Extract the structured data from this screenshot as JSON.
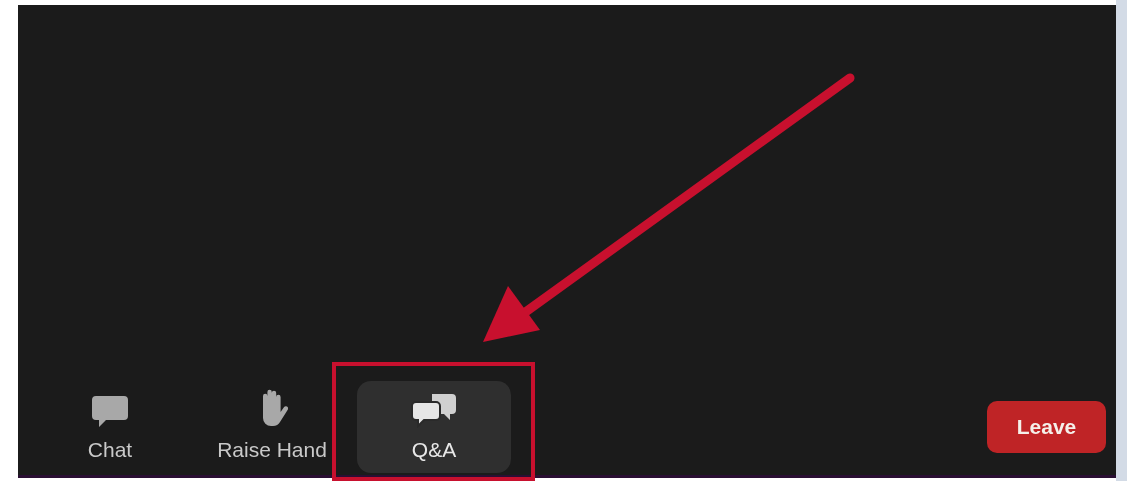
{
  "toolbar": [
    {
      "kind": "chat",
      "label": "Chat",
      "selected": false,
      "annotated": false
    },
    {
      "kind": "hand",
      "label": "Raise Hand",
      "selected": false,
      "annotated": false
    },
    {
      "kind": "qa",
      "label": "Q&A",
      "selected": true,
      "annotated": true
    }
  ],
  "leave_button": {
    "label": "Leave"
  }
}
